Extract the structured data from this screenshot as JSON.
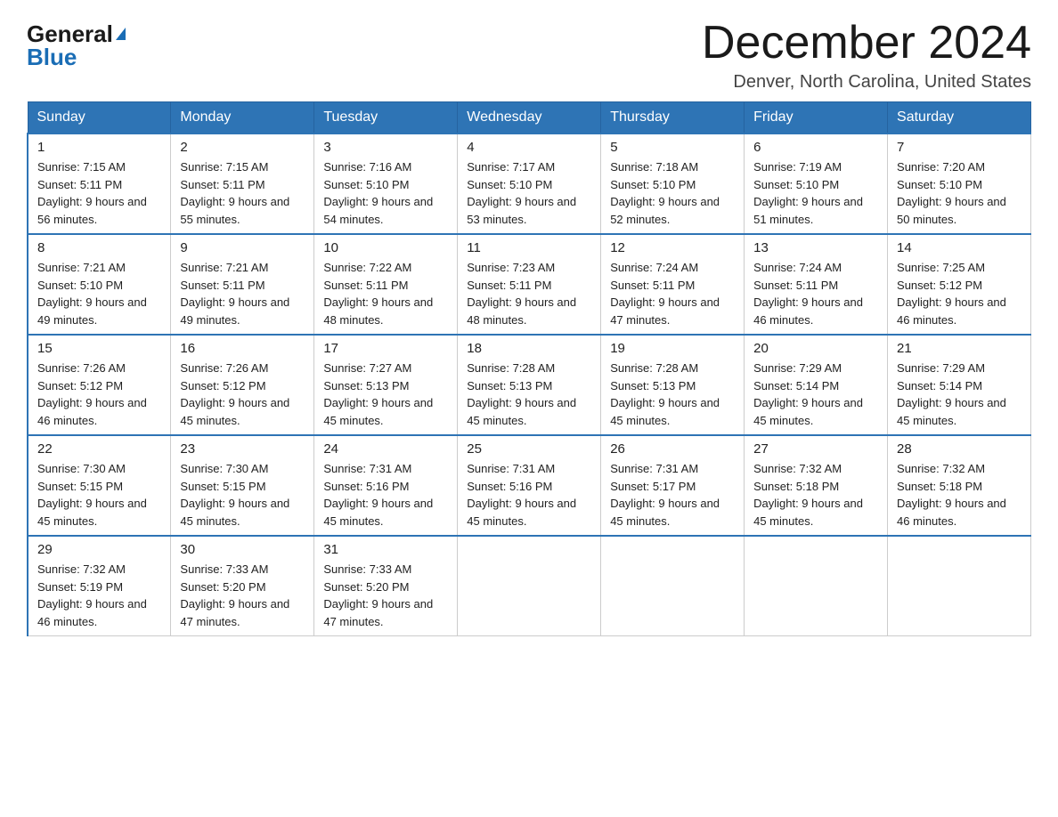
{
  "logo": {
    "general": "General",
    "triangle": "▶",
    "blue": "Blue"
  },
  "header": {
    "month_title": "December 2024",
    "location": "Denver, North Carolina, United States"
  },
  "days_of_week": [
    "Sunday",
    "Monday",
    "Tuesday",
    "Wednesday",
    "Thursday",
    "Friday",
    "Saturday"
  ],
  "weeks": [
    [
      {
        "day": "1",
        "sunrise": "Sunrise: 7:15 AM",
        "sunset": "Sunset: 5:11 PM",
        "daylight": "Daylight: 9 hours and 56 minutes."
      },
      {
        "day": "2",
        "sunrise": "Sunrise: 7:15 AM",
        "sunset": "Sunset: 5:11 PM",
        "daylight": "Daylight: 9 hours and 55 minutes."
      },
      {
        "day": "3",
        "sunrise": "Sunrise: 7:16 AM",
        "sunset": "Sunset: 5:10 PM",
        "daylight": "Daylight: 9 hours and 54 minutes."
      },
      {
        "day": "4",
        "sunrise": "Sunrise: 7:17 AM",
        "sunset": "Sunset: 5:10 PM",
        "daylight": "Daylight: 9 hours and 53 minutes."
      },
      {
        "day": "5",
        "sunrise": "Sunrise: 7:18 AM",
        "sunset": "Sunset: 5:10 PM",
        "daylight": "Daylight: 9 hours and 52 minutes."
      },
      {
        "day": "6",
        "sunrise": "Sunrise: 7:19 AM",
        "sunset": "Sunset: 5:10 PM",
        "daylight": "Daylight: 9 hours and 51 minutes."
      },
      {
        "day": "7",
        "sunrise": "Sunrise: 7:20 AM",
        "sunset": "Sunset: 5:10 PM",
        "daylight": "Daylight: 9 hours and 50 minutes."
      }
    ],
    [
      {
        "day": "8",
        "sunrise": "Sunrise: 7:21 AM",
        "sunset": "Sunset: 5:10 PM",
        "daylight": "Daylight: 9 hours and 49 minutes."
      },
      {
        "day": "9",
        "sunrise": "Sunrise: 7:21 AM",
        "sunset": "Sunset: 5:11 PM",
        "daylight": "Daylight: 9 hours and 49 minutes."
      },
      {
        "day": "10",
        "sunrise": "Sunrise: 7:22 AM",
        "sunset": "Sunset: 5:11 PM",
        "daylight": "Daylight: 9 hours and 48 minutes."
      },
      {
        "day": "11",
        "sunrise": "Sunrise: 7:23 AM",
        "sunset": "Sunset: 5:11 PM",
        "daylight": "Daylight: 9 hours and 48 minutes."
      },
      {
        "day": "12",
        "sunrise": "Sunrise: 7:24 AM",
        "sunset": "Sunset: 5:11 PM",
        "daylight": "Daylight: 9 hours and 47 minutes."
      },
      {
        "day": "13",
        "sunrise": "Sunrise: 7:24 AM",
        "sunset": "Sunset: 5:11 PM",
        "daylight": "Daylight: 9 hours and 46 minutes."
      },
      {
        "day": "14",
        "sunrise": "Sunrise: 7:25 AM",
        "sunset": "Sunset: 5:12 PM",
        "daylight": "Daylight: 9 hours and 46 minutes."
      }
    ],
    [
      {
        "day": "15",
        "sunrise": "Sunrise: 7:26 AM",
        "sunset": "Sunset: 5:12 PM",
        "daylight": "Daylight: 9 hours and 46 minutes."
      },
      {
        "day": "16",
        "sunrise": "Sunrise: 7:26 AM",
        "sunset": "Sunset: 5:12 PM",
        "daylight": "Daylight: 9 hours and 45 minutes."
      },
      {
        "day": "17",
        "sunrise": "Sunrise: 7:27 AM",
        "sunset": "Sunset: 5:13 PM",
        "daylight": "Daylight: 9 hours and 45 minutes."
      },
      {
        "day": "18",
        "sunrise": "Sunrise: 7:28 AM",
        "sunset": "Sunset: 5:13 PM",
        "daylight": "Daylight: 9 hours and 45 minutes."
      },
      {
        "day": "19",
        "sunrise": "Sunrise: 7:28 AM",
        "sunset": "Sunset: 5:13 PM",
        "daylight": "Daylight: 9 hours and 45 minutes."
      },
      {
        "day": "20",
        "sunrise": "Sunrise: 7:29 AM",
        "sunset": "Sunset: 5:14 PM",
        "daylight": "Daylight: 9 hours and 45 minutes."
      },
      {
        "day": "21",
        "sunrise": "Sunrise: 7:29 AM",
        "sunset": "Sunset: 5:14 PM",
        "daylight": "Daylight: 9 hours and 45 minutes."
      }
    ],
    [
      {
        "day": "22",
        "sunrise": "Sunrise: 7:30 AM",
        "sunset": "Sunset: 5:15 PM",
        "daylight": "Daylight: 9 hours and 45 minutes."
      },
      {
        "day": "23",
        "sunrise": "Sunrise: 7:30 AM",
        "sunset": "Sunset: 5:15 PM",
        "daylight": "Daylight: 9 hours and 45 minutes."
      },
      {
        "day": "24",
        "sunrise": "Sunrise: 7:31 AM",
        "sunset": "Sunset: 5:16 PM",
        "daylight": "Daylight: 9 hours and 45 minutes."
      },
      {
        "day": "25",
        "sunrise": "Sunrise: 7:31 AM",
        "sunset": "Sunset: 5:16 PM",
        "daylight": "Daylight: 9 hours and 45 minutes."
      },
      {
        "day": "26",
        "sunrise": "Sunrise: 7:31 AM",
        "sunset": "Sunset: 5:17 PM",
        "daylight": "Daylight: 9 hours and 45 minutes."
      },
      {
        "day": "27",
        "sunrise": "Sunrise: 7:32 AM",
        "sunset": "Sunset: 5:18 PM",
        "daylight": "Daylight: 9 hours and 45 minutes."
      },
      {
        "day": "28",
        "sunrise": "Sunrise: 7:32 AM",
        "sunset": "Sunset: 5:18 PM",
        "daylight": "Daylight: 9 hours and 46 minutes."
      }
    ],
    [
      {
        "day": "29",
        "sunrise": "Sunrise: 7:32 AM",
        "sunset": "Sunset: 5:19 PM",
        "daylight": "Daylight: 9 hours and 46 minutes."
      },
      {
        "day": "30",
        "sunrise": "Sunrise: 7:33 AM",
        "sunset": "Sunset: 5:20 PM",
        "daylight": "Daylight: 9 hours and 47 minutes."
      },
      {
        "day": "31",
        "sunrise": "Sunrise: 7:33 AM",
        "sunset": "Sunset: 5:20 PM",
        "daylight": "Daylight: 9 hours and 47 minutes."
      },
      null,
      null,
      null,
      null
    ]
  ]
}
